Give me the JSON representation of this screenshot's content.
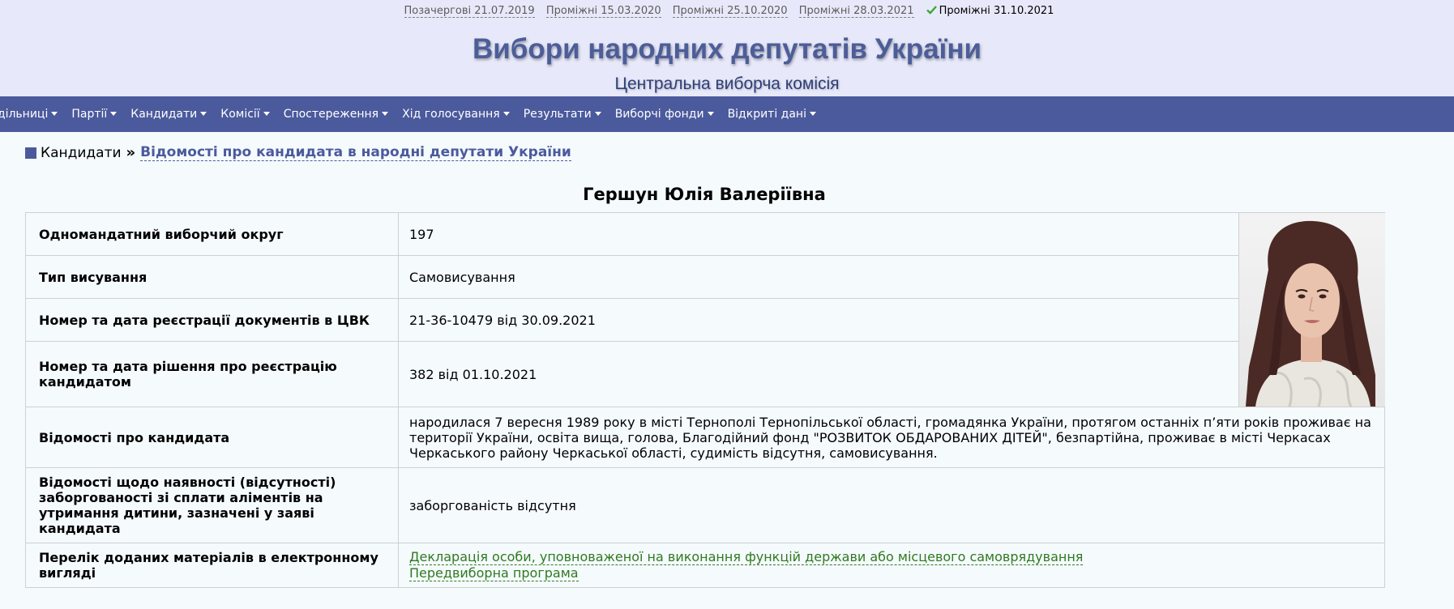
{
  "elections": [
    {
      "label": "Позачергові 21.07.2019"
    },
    {
      "label": "Проміжні 15.03.2020"
    },
    {
      "label": "Проміжні 25.10.2020"
    },
    {
      "label": "Проміжні 28.03.2021"
    }
  ],
  "current_election": "Проміжні 31.10.2021",
  "site": {
    "title": "Вибори народних депутатів України",
    "subtitle": "Центральна виборча комісія"
  },
  "nav": [
    ", дільниці",
    "Партії",
    "Кандидати",
    "Комісії",
    "Спостереження",
    "Хід голосування",
    "Результати",
    "Виборчі фонди",
    "Відкриті дані"
  ],
  "breadcrumb": {
    "parent": "Кандидати",
    "separator": "»",
    "current": "Відомості про кандидата в народні депутати України"
  },
  "candidate": {
    "name": "Гершун Юлія Валеріївна",
    "rows": [
      {
        "label": "Одномандатний виборчий округ",
        "value": "197"
      },
      {
        "label": "Тип висування",
        "value": "Самовисування"
      },
      {
        "label": "Номер та дата реєстрації документів в ЦВК",
        "value": "21-36-10479 від 30.09.2021"
      },
      {
        "label": "Номер та дата рішення про реєстрацію кандидатом",
        "value": "382 від 01.10.2021"
      },
      {
        "label": "Відомості про кандидата",
        "value": "народилася 7 вересня 1989 року в місті Тернополі Тернопільської області, громадянка України, протягом останніх п’яти років проживає на території України, освіта вища, голова, Благодійний фонд \"РОЗВИТОК ОБДАРОВАНИХ ДІТЕЙ\", безпартійна, проживає в місті Черкасах Черкаського району Черкаської області, судимість відсутня, самовисування."
      },
      {
        "label": "Відомості щодо наявності (відсутності) заборгованості зі сплати аліментів на утримання дитини, зазначені у заяві кандидата",
        "value": "заборгованість відсутня"
      },
      {
        "label": "Перелік доданих матеріалів в електронному вигляді",
        "links": [
          "Декларація особи, уповноваженої на виконання функцій держави або місцевого самоврядування",
          "Передвиборна програма"
        ]
      }
    ]
  },
  "colors": {
    "header_bg": "#e7e9fa",
    "nav_bg": "#4b5a9c",
    "title": "#4c5d99",
    "link_green": "#2f7a1f",
    "page_bg": "#f5fafd"
  }
}
